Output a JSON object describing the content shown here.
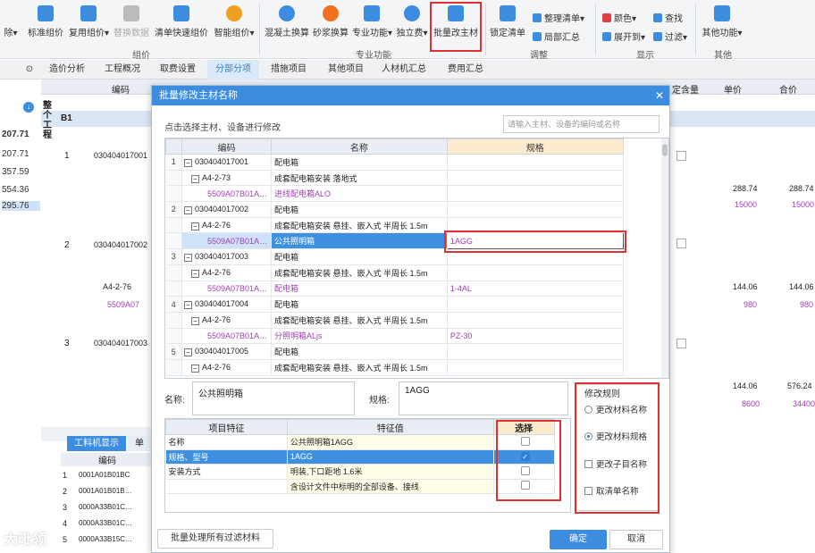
{
  "toolbar": {
    "buttons": [
      {
        "label": "除▾",
        "icon": "unknown-icon"
      },
      {
        "label": "标准组价",
        "icon": "grid-icon"
      },
      {
        "label": "复用组价▾",
        "icon": "reuse-icon"
      },
      {
        "label": "替换数据",
        "icon": "replace-icon"
      },
      {
        "label": "清单快速组价",
        "icon": "quick-icon"
      },
      {
        "label": "智能组价▾",
        "icon": "smart-icon"
      },
      {
        "label": "混凝土换算",
        "icon": "concrete-icon"
      },
      {
        "label": "砂浆换算",
        "icon": "mortar-icon"
      },
      {
        "label": "专业功能▾",
        "icon": "professional-icon"
      },
      {
        "label": "独立费▾",
        "icon": "fee-icon"
      },
      {
        "label": "批量改主材",
        "icon": "batch-edit-icon"
      },
      {
        "label": "锁定清单",
        "icon": "lock-icon"
      }
    ],
    "small": [
      "整理清单▾",
      "局部汇总",
      "颜色▾",
      "展开到▾",
      "查找",
      "过滤▾",
      "其他功能▾"
    ],
    "groups": [
      "组价",
      "专业功能",
      "调整",
      "显示",
      "其他"
    ]
  },
  "tabs": [
    "造价分析",
    "工程概况",
    "取费设置",
    "分部分项",
    "措施项目",
    "其他项目",
    "人材机汇总",
    "费用汇总"
  ],
  "left_values": [
    "207.71",
    "207.71",
    "357.59",
    "554.36",
    "295.76"
  ],
  "bg": {
    "headers": [
      "编码",
      "定含量",
      "单价",
      "合价"
    ],
    "rows": [
      "整个工程",
      "B1",
      "1",
      "2",
      "3"
    ],
    "codes": [
      "030404017001",
      "030404017002",
      "030404017003",
      "A4-2-76",
      "5509A07"
    ],
    "prices": [
      "288.74",
      "288.74",
      "15000",
      "15000",
      "144.06",
      "144.06",
      "980",
      "980",
      "144.06",
      "576.24",
      "8600",
      "34400"
    ],
    "bottom_tabs": [
      "工料机显示",
      "单"
    ],
    "bottom_header": "编码",
    "bottom_rows": [
      "0001A01B01BC",
      "0001A01B01B…",
      "0000A33B01C…",
      "0000A33B01C…",
      "0000A33B15C…"
    ]
  },
  "dialog": {
    "title": "批量修改主材名称",
    "hint": "点击选择主材、设备进行修改",
    "search_placeholder": "请输入主材、设备的编码或名称",
    "grid_headers": [
      "编码",
      "名称",
      "规格"
    ],
    "rows": [
      {
        "n": "1",
        "code": "030404017001",
        "name": "配电箱",
        "spec": "",
        "lvl": 0,
        "purple": false
      },
      {
        "n": "",
        "code": "A4-2-73",
        "name": "成套配电箱安装 落地式",
        "spec": "",
        "lvl": 1,
        "purple": false
      },
      {
        "n": "",
        "code": "5509A07B01A…",
        "name": "进线配电箱ALO",
        "spec": "",
        "lvl": 2,
        "purple": true
      },
      {
        "n": "2",
        "code": "030404017002",
        "name": "配电箱",
        "spec": "",
        "lvl": 0,
        "purple": false
      },
      {
        "n": "",
        "code": "A4-2-76",
        "name": "成套配电箱安装 悬挂、嵌入式 半周长 1.5m",
        "spec": "",
        "lvl": 1,
        "purple": false
      },
      {
        "n": "",
        "code": "5509A07B01A…",
        "name": "公共照明箱",
        "spec": "1AGG",
        "lvl": 2,
        "purple": true,
        "selected": true
      },
      {
        "n": "3",
        "code": "030404017003",
        "name": "配电箱",
        "spec": "",
        "lvl": 0,
        "purple": false
      },
      {
        "n": "",
        "code": "A4-2-76",
        "name": "成套配电箱安装 悬挂、嵌入式 半周长 1.5m",
        "spec": "",
        "lvl": 1,
        "purple": false
      },
      {
        "n": "",
        "code": "5509A07B01A…",
        "name": "配电箱",
        "spec": "1-4AL",
        "lvl": 2,
        "purple": true
      },
      {
        "n": "4",
        "code": "030404017004",
        "name": "配电箱",
        "spec": "",
        "lvl": 0,
        "purple": false
      },
      {
        "n": "",
        "code": "A4-2-76",
        "name": "成套配电箱安装 悬挂、嵌入式 半周长 1.5m",
        "spec": "",
        "lvl": 1,
        "purple": false
      },
      {
        "n": "",
        "code": "5509A07B01A…",
        "name": "分照明箱ALjs",
        "spec": "PZ-30",
        "lvl": 2,
        "purple": true
      },
      {
        "n": "5",
        "code": "030404017005",
        "name": "配电箱",
        "spec": "",
        "lvl": 0,
        "purple": false
      },
      {
        "n": "",
        "code": "A4-2-76",
        "name": "成套配电箱安装 悬挂、嵌入式 半周长 1.5m",
        "spec": "",
        "lvl": 1,
        "purple": false
      }
    ],
    "name_label": "名称:",
    "name_value": "公共照明箱",
    "spec_label": "规格:",
    "spec_value": "1AGG",
    "rules_title": "修改规则",
    "rules": [
      {
        "label": "更改材料名称",
        "type": "radio",
        "on": false
      },
      {
        "label": "更改材料规格",
        "type": "radio",
        "on": true
      },
      {
        "label": "更改子目名称",
        "type": "check",
        "on": false
      },
      {
        "label": "取清单名称",
        "type": "check",
        "on": false
      }
    ],
    "feat_headers": [
      "项目特征",
      "特征值",
      "选择"
    ],
    "features": [
      {
        "name": "名称",
        "value": "公共照明箱1AGG",
        "checked": false
      },
      {
        "name": "规格、型号",
        "value": "1AGG",
        "checked": true,
        "selected": true
      },
      {
        "name": "安装方式",
        "value": "明装,下口距地 1.6米",
        "checked": false
      },
      {
        "name": "",
        "value": "含设计文件中标明的全部设备、接线",
        "checked": false
      }
    ],
    "btn_batch": "批量处理所有过滤材料",
    "btn_ok": "确定",
    "btn_cancel": "取消"
  },
  "watermark": "大毗领"
}
